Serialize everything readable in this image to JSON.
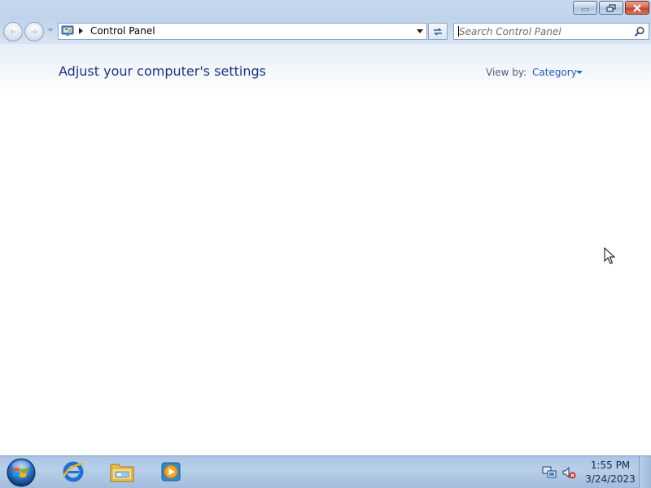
{
  "window": {
    "address": {
      "location": "Control Panel"
    },
    "search": {
      "placeholder": "Search Control Panel"
    },
    "content": {
      "title": "Adjust your computer's settings",
      "view_by_label": "View by:",
      "view_by_value": "Category"
    }
  },
  "taskbar": {
    "pinned_apps": [
      {
        "name": "internet-explorer-icon"
      },
      {
        "name": "windows-explorer-icon"
      },
      {
        "name": "windows-media-player-icon"
      }
    ],
    "tray_icons": [
      {
        "name": "network-icon"
      },
      {
        "name": "volume-muted-icon"
      }
    ],
    "clock": {
      "time": "1:55 PM",
      "date": "3/24/2023"
    }
  },
  "colors": {
    "title_blue": "#1e3287",
    "link_blue": "#1e5ec8",
    "close_red": "#c4432a"
  }
}
